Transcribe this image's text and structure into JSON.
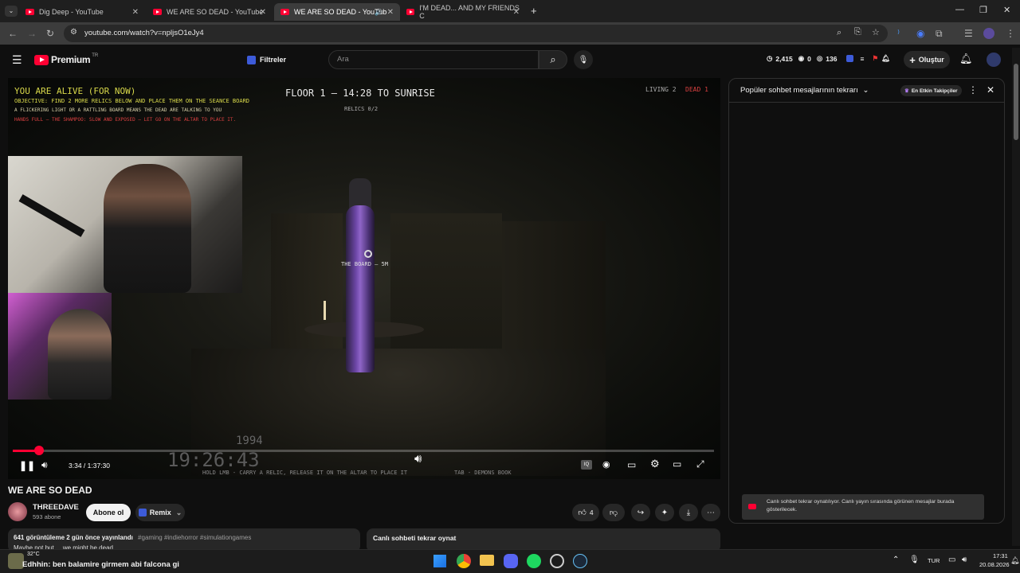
{
  "browser": {
    "tabs": [
      {
        "label": "Dig Deep - YouTube",
        "active": false
      },
      {
        "label": "WE ARE SO DEAD - YouTube",
        "active": false
      },
      {
        "label": "WE ARE SO DEAD - YouTub",
        "active": true
      },
      {
        "label": "I'M DEAD... AND MY FRIENDS C",
        "active": false
      }
    ],
    "new_tab_label": "+",
    "url": "youtube.com/watch?v=npljsO1eJy4"
  },
  "youtube_header": {
    "logo_label": "Premium",
    "logo_region": "TR",
    "filter_label": "Filtreler",
    "search_placeholder": "Ara",
    "stats": {
      "views": "2,415",
      "zero": "0",
      "count": "136"
    },
    "create_label": "Oluştur"
  },
  "game_hud": {
    "status": "YOU ARE ALIVE (FOR NOW)",
    "objective": "OBJECTIVE: FIND 2 MORE RELICS BELOW AND PLACE THEM ON THE SEANCE BOARD",
    "hint1": "A FLICKERING LIGHT OR A RATTLING BOARD MEANS THE DEAD ARE TALKING TO YOU",
    "hint2": "HANDS FULL — THE SHAMPOO: SLOW AND EXPOSED — LET GO ON THE ALTAR TO PLACE IT.",
    "floor": "FLOOR 1 — 14:28 TO SUNRISE",
    "relics": "RELICS 0/2",
    "living": "LIVING 2",
    "dead": "DEAD 1",
    "board_label": "THE BOARD — 5M",
    "year": "1994",
    "clock": "19:26:43",
    "controls_hint_left": "HOLD LMB - CARRY A RELIC, RELEASE IT ON THE ALTAR TO PLACE IT",
    "controls_hint_right": "TAB - DEMONS BOOK"
  },
  "player": {
    "time": "3:34 / 1:37:30",
    "progress": 0.038
  },
  "video": {
    "title": "WE ARE SO DEAD",
    "channel": "THREEDAVE",
    "subscribers": "593 abone",
    "subscribe_label": "Abone ol",
    "remix_label": "Remix",
    "likes": "4",
    "description_meta": "641 görüntüleme  2 gün önce yayınlandı",
    "hashtags": "#gaming #indiehorror #simulationgames",
    "description_preview": "Maybe not but ... we might be dead",
    "chat_replay_label": "Canlı sohbeti tekrar oynat"
  },
  "chat": {
    "header": "Popüler sohbet mesajlarının tekrarı",
    "top_fans_label": "En Etkin Takipçiler",
    "notice": "Canlı sohbet tekrar oynatılıyor. Canlı yayın sırasında görünen mesajlar burada gösterilecek."
  },
  "taskbar": {
    "weather": "32°C",
    "notification": "Edhhin: ben balamire girmem abi falcona gi",
    "lang": "TUR",
    "time": "17:31",
    "date": "20.08.2026"
  }
}
